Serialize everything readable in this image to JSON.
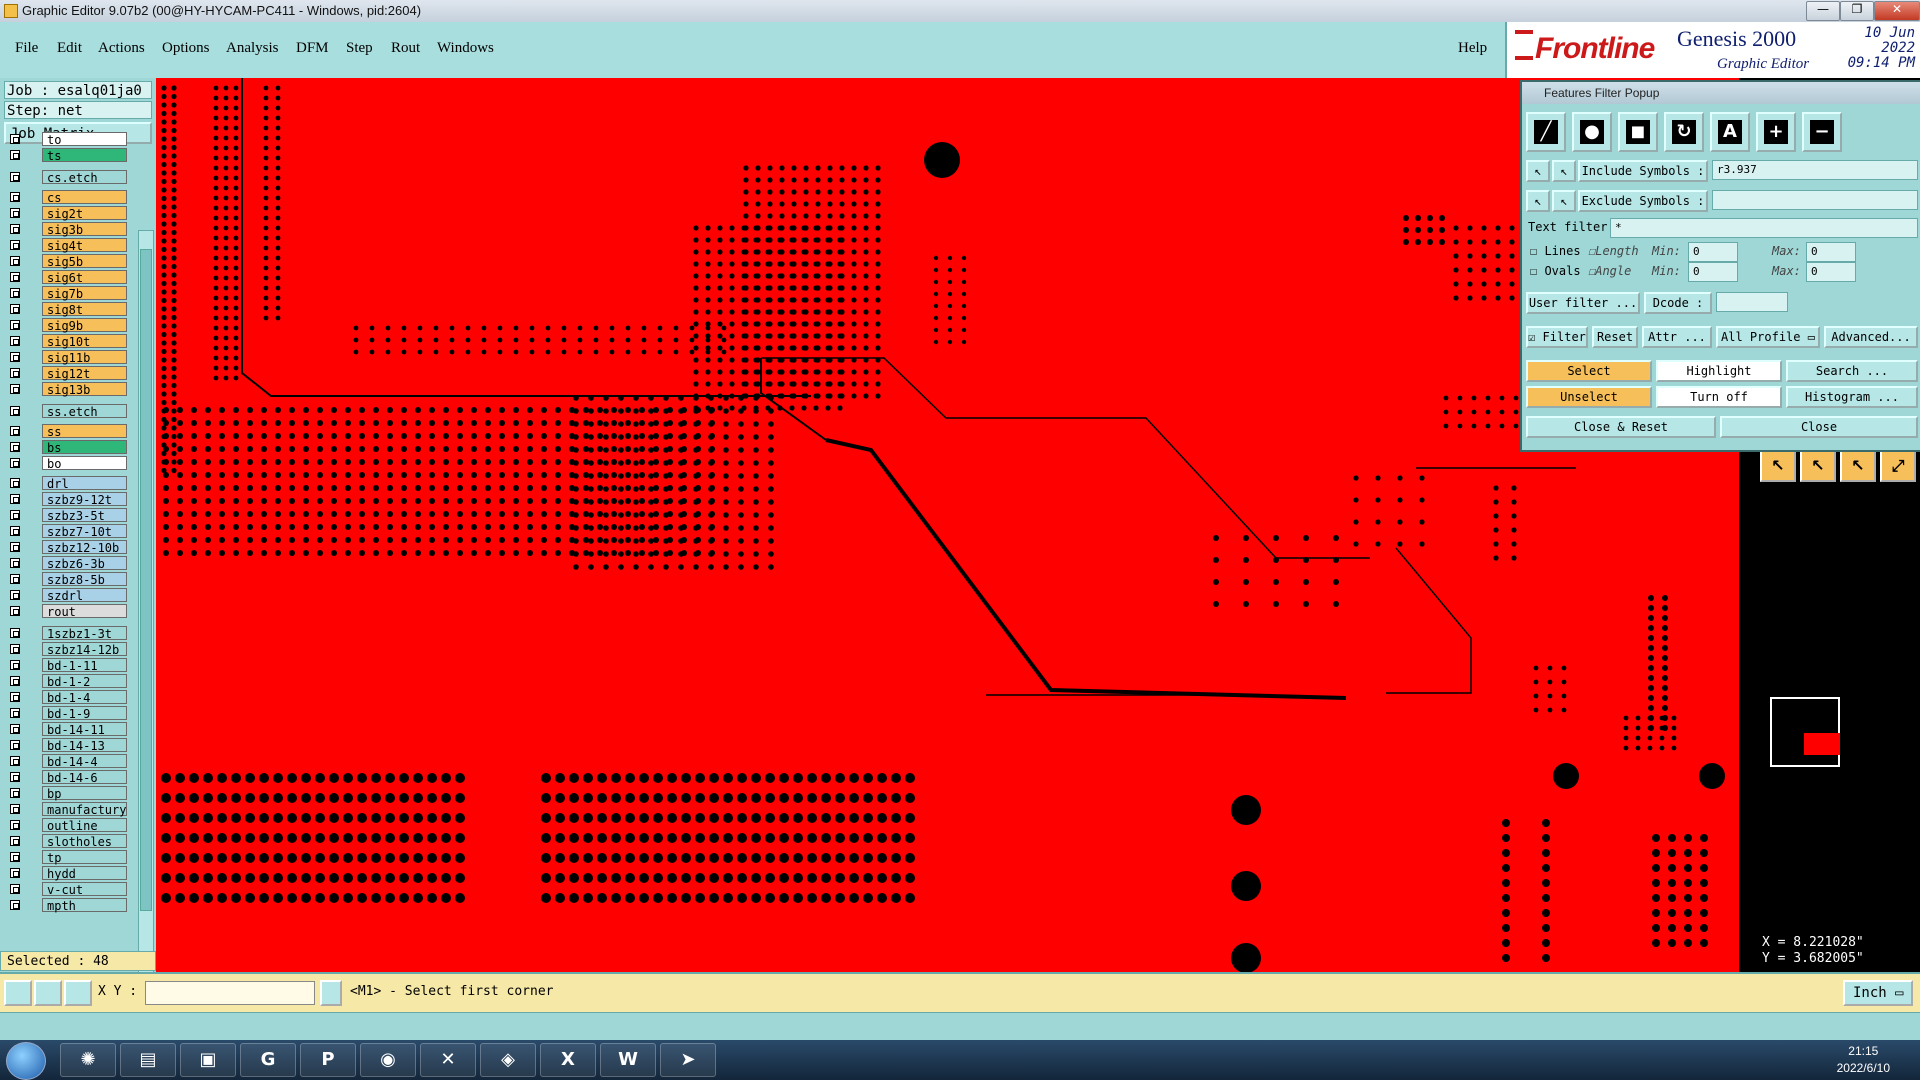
{
  "window": {
    "title": "Graphic Editor 9.07b2 (00@HY-HYCAM-PC411 - Windows, pid:2604)",
    "controls": [
      "—",
      "❐",
      "✕"
    ]
  },
  "menu": [
    "File",
    "Edit",
    "Actions",
    "Options",
    "Analysis",
    "DFM",
    "Step",
    "Rout",
    "Windows"
  ],
  "help": "Help",
  "brand": {
    "logo": "Frontline",
    "product": "Genesis 2000",
    "subtitle": "Graphic Editor",
    "date": "10 Jun 2022",
    "time": "09:14 PM"
  },
  "job": {
    "job_line": "Job : esalq01ja0",
    "step_line": "Step: net",
    "matrix_button": "Job Matrix ..."
  },
  "layers": [
    {
      "name": "to",
      "color": "white"
    },
    {
      "name": "ts",
      "color": "green"
    },
    {
      "name": "cs.etch",
      "color": "cyan"
    },
    {
      "name": "cs",
      "color": "orange"
    },
    {
      "name": "sig2t",
      "color": "orange"
    },
    {
      "name": "sig3b",
      "color": "orange"
    },
    {
      "name": "sig4t",
      "color": "orange"
    },
    {
      "name": "sig5b",
      "color": "orange"
    },
    {
      "name": "sig6t",
      "color": "orange"
    },
    {
      "name": "sig7b",
      "color": "orange"
    },
    {
      "name": "sig8t",
      "color": "orange"
    },
    {
      "name": "sig9b",
      "color": "orange"
    },
    {
      "name": "sig10t",
      "color": "orange"
    },
    {
      "name": "sig11b",
      "color": "orange"
    },
    {
      "name": "sig12t",
      "color": "orange"
    },
    {
      "name": "sig13b",
      "color": "orange"
    },
    {
      "name": "ss.etch",
      "color": "cyan"
    },
    {
      "name": "ss",
      "color": "orange"
    },
    {
      "name": "bs",
      "color": "green"
    },
    {
      "name": "bo",
      "color": "white"
    },
    {
      "name": "drl",
      "color": "blue"
    },
    {
      "name": "szbz9-12t",
      "color": "blue"
    },
    {
      "name": "szbz3-5t",
      "color": "blue"
    },
    {
      "name": "szbz7-10t",
      "color": "blue"
    },
    {
      "name": "szbz12-10b",
      "color": "blue"
    },
    {
      "name": "szbz6-3b",
      "color": "blue"
    },
    {
      "name": "szbz8-5b",
      "color": "blue"
    },
    {
      "name": "szdrl",
      "color": "blue"
    },
    {
      "name": "rout",
      "color": "gray"
    },
    {
      "name": "1szbz1-3t",
      "color": "cyan"
    },
    {
      "name": "szbz14-12b",
      "color": "cyan"
    },
    {
      "name": "bd-1-11",
      "color": "cyan"
    },
    {
      "name": "bd-1-2",
      "color": "cyan"
    },
    {
      "name": "bd-1-4",
      "color": "cyan"
    },
    {
      "name": "bd-1-9",
      "color": "cyan"
    },
    {
      "name": "bd-14-11",
      "color": "cyan"
    },
    {
      "name": "bd-14-13",
      "color": "cyan"
    },
    {
      "name": "bd-14-4",
      "color": "cyan"
    },
    {
      "name": "bd-14-6",
      "color": "cyan"
    },
    {
      "name": "bp",
      "color": "cyan"
    },
    {
      "name": "manufactury",
      "color": "cyan"
    },
    {
      "name": "outline",
      "color": "cyan"
    },
    {
      "name": "slotholes",
      "color": "cyan"
    },
    {
      "name": "tp",
      "color": "cyan"
    },
    {
      "name": "hydd",
      "color": "cyan"
    },
    {
      "name": "v-cut",
      "color": "cyan"
    },
    {
      "name": "mpth",
      "color": "cyan"
    }
  ],
  "selected": "Selected : 48",
  "filter": {
    "title": "Features Filter Popup",
    "include_label": "Include Symbols :",
    "include_value": "r3.937",
    "exclude_label": "Exclude Symbols :",
    "exclude_value": "",
    "text_filter_label": "Text filter",
    "text_filter_value": "*",
    "lines": "Lines",
    "ovals": "Ovals",
    "length": "Length",
    "angle": "Angle",
    "min": "Min:",
    "max": "Max:",
    "min_val": "0",
    "max_val": "0",
    "user_filter": "User filter ...",
    "dcode": "Dcode :",
    "filter_toggle": "Filter",
    "reset": "Reset",
    "attr": "Attr ...",
    "profile": "All Profile",
    "advanced": "Advanced...",
    "select": "Select",
    "highlight": "Highlight",
    "search": "Search ...",
    "unselect": "Unselect",
    "turn_off": "Turn off",
    "histogram": "Histogram ...",
    "close_reset": "Close & Reset",
    "close": "Close"
  },
  "coords": {
    "x": "X = 8.221028\"",
    "y": "Y = 3.682005\""
  },
  "status": {
    "xy_label": "X Y :",
    "prompt": "<M1> - Select first corner",
    "units": "Inch"
  },
  "clock": {
    "time": "21:15",
    "date": "2022/6/10"
  }
}
